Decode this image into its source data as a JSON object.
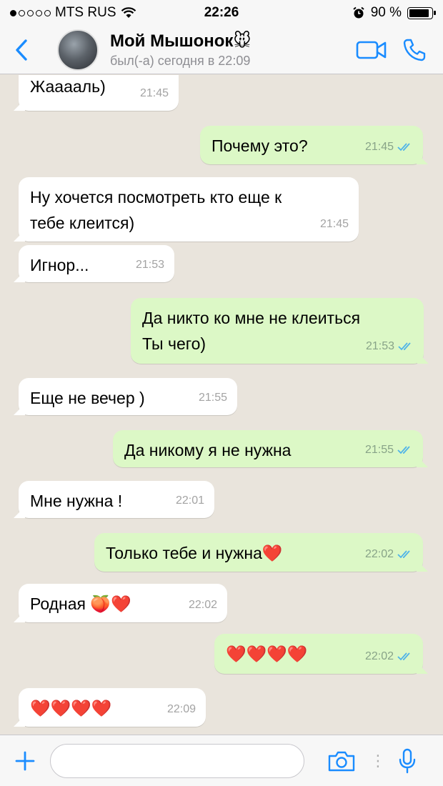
{
  "status_bar": {
    "carrier": "MTS RUS",
    "time": "22:26",
    "battery": "90 %",
    "battery_level": 0.9
  },
  "header": {
    "contact_name": "Мой Мышонок🐭",
    "last_seen": "был(-а) сегодня в 22:09"
  },
  "messages": [
    {
      "dir": "in",
      "text": "Жааааль)",
      "time": "21:45"
    },
    {
      "dir": "out",
      "text": "Почему это?",
      "time": "21:45"
    },
    {
      "dir": "in",
      "text": "Ну хочется посмотреть кто еще к\nтебе клеится)",
      "time": "21:45"
    },
    {
      "dir": "in",
      "text": "Игнор...",
      "time": "21:53"
    },
    {
      "dir": "out",
      "text": "Да никто ко мне не клеиться\nТы чего)",
      "time": "21:53"
    },
    {
      "dir": "in",
      "text": "Еще не вечер )",
      "time": "21:55"
    },
    {
      "dir": "out",
      "text": "Да никому я не нужна",
      "time": "21:55"
    },
    {
      "dir": "in",
      "text": "Мне нужна !",
      "time": "22:01"
    },
    {
      "dir": "out",
      "text": "Только тебе и нужна❤️",
      "time": "22:02"
    },
    {
      "dir": "in",
      "text": "Родная 🍑❤️",
      "time": "22:02"
    },
    {
      "dir": "out",
      "text": "❤️❤️❤️❤️",
      "time": "22:02"
    },
    {
      "dir": "in",
      "text": "❤️❤️❤️❤️",
      "time": "22:09"
    }
  ],
  "colors": {
    "accent": "#1a8cff",
    "incoming_bubble": "#ffffff",
    "outgoing_bubble": "#dcf8c6",
    "read_ticks": "#4fb3e8"
  },
  "icons": [
    "back-chevron-icon",
    "video-call-icon",
    "phone-icon",
    "plus-icon",
    "camera-icon",
    "microphone-icon",
    "double-check-icon"
  ]
}
